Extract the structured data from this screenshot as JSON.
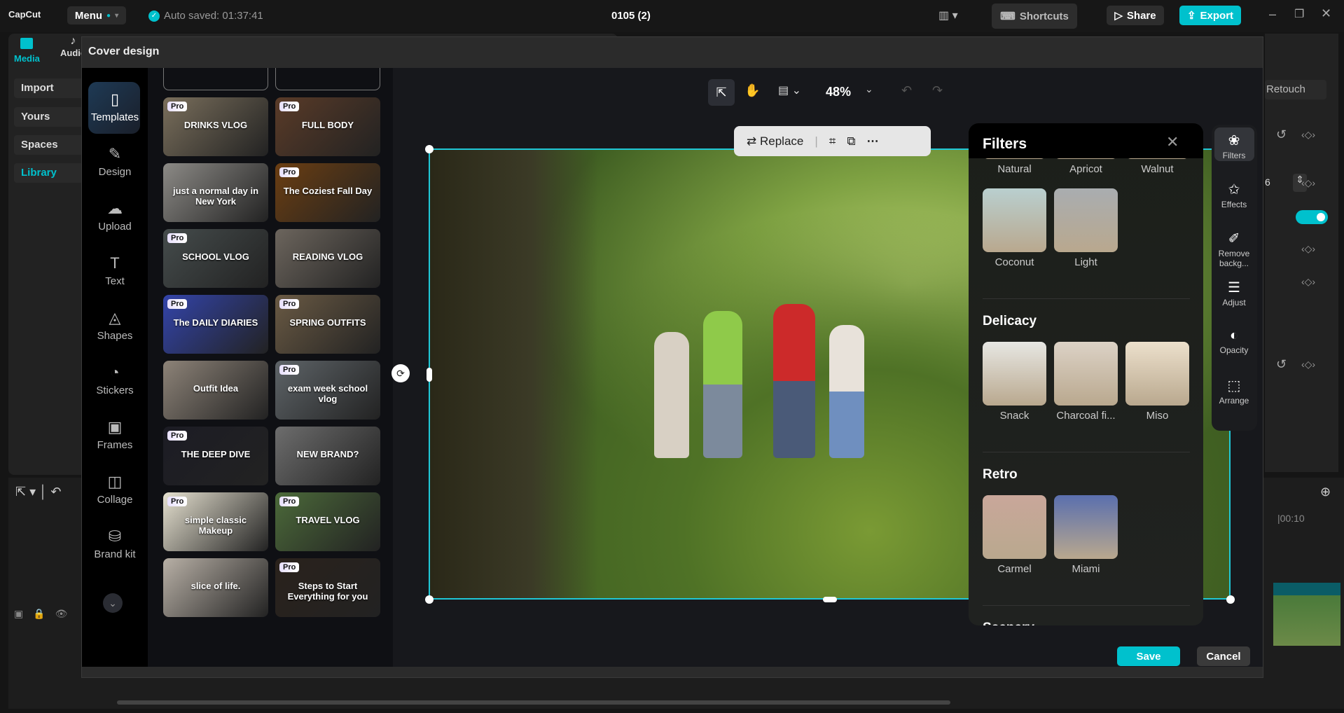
{
  "app": {
    "logo": "CapCut",
    "menu": "Menu",
    "autosave": "Auto saved: 01:37:41",
    "title": "0105 (2)",
    "shortcuts": "Shortcuts",
    "share": "Share",
    "export": "Export"
  },
  "colors": {
    "accent": "#00c1cd",
    "bg": "#151515"
  },
  "media_panel": {
    "tabs": [
      "Media",
      "Audio"
    ],
    "items": [
      "Import",
      "Yours",
      "Spaces",
      "Library"
    ],
    "active": "Library"
  },
  "right_panel": {
    "retouch": "Retouch",
    "value": "6",
    "timecode": "|00:10"
  },
  "modal": {
    "title": "Cover design",
    "save": "Save",
    "cancel": "Cancel",
    "tools": [
      {
        "label": "Templates",
        "icon": "templates-icon"
      },
      {
        "label": "Design",
        "icon": "design-icon"
      },
      {
        "label": "Upload",
        "icon": "upload-icon"
      },
      {
        "label": "Text",
        "icon": "text-icon"
      },
      {
        "label": "Shapes",
        "icon": "shapes-icon"
      },
      {
        "label": "Stickers",
        "icon": "stickers-icon"
      },
      {
        "label": "Frames",
        "icon": "frames-icon"
      },
      {
        "label": "Collage",
        "icon": "collage-icon"
      },
      {
        "label": "Brand kit",
        "icon": "brand-kit-icon"
      }
    ],
    "templates": [
      {
        "text": "DRINKS VLOG",
        "pro": true,
        "bg": "#7a6f5c"
      },
      {
        "text": "FULL BODY",
        "pro": true,
        "bg": "#5a3b28"
      },
      {
        "text": "just a normal day in New York",
        "pro": false,
        "bg": "#8c8a86"
      },
      {
        "text": "The Coziest Fall Day",
        "pro": true,
        "bg": "#6b3e12"
      },
      {
        "text": "SCHOOL VLOG",
        "pro": true,
        "bg": "#454c4c"
      },
      {
        "text": "READING VLOG",
        "pro": false,
        "bg": "#6c655d"
      },
      {
        "text": "The DAILY DIARIES",
        "pro": true,
        "bg": "#3344aa"
      },
      {
        "text": "SPRING OUTFITS",
        "pro": true,
        "bg": "#6a5a44"
      },
      {
        "text": "Outfit Idea",
        "pro": false,
        "bg": "#8d8378"
      },
      {
        "text": "exam week school vlog",
        "pro": true,
        "bg": "#5e6468"
      },
      {
        "text": "THE DEEP DIVE",
        "pro": true,
        "bg": "#1c1c24"
      },
      {
        "text": "NEW BRAND?",
        "pro": false,
        "bg": "#6d6d6d"
      },
      {
        "text": "simple classic Makeup",
        "pro": true,
        "bg": "#e6e1d0"
      },
      {
        "text": "TRAVEL VLOG",
        "pro": true,
        "bg": "#4c6a3a"
      },
      {
        "text": "slice of life.",
        "pro": false,
        "bg": "#b8b0a6"
      },
      {
        "text": "Steps to Start Everything for you",
        "pro": true,
        "bg": "#2a221c"
      }
    ],
    "zoom": "48%",
    "float_toolbar": {
      "replace": "Replace"
    }
  },
  "filters": {
    "title": "Filters",
    "sections": [
      {
        "name": "",
        "items": [
          {
            "label": "Natural",
            "color": "#d8d2c8"
          },
          {
            "label": "Apricot",
            "color": "#efe4d2"
          },
          {
            "label": "Walnut",
            "color": "#eadccb"
          },
          {
            "label": "Coconut",
            "color": "#b9cfcf"
          },
          {
            "label": "Light",
            "color": "#a9adb0"
          }
        ]
      },
      {
        "name": "Delicacy",
        "items": [
          {
            "label": "Snack",
            "color": "#e7e7e3"
          },
          {
            "label": "Charcoal fi...",
            "color": "#dcd2c6"
          },
          {
            "label": "Miso",
            "color": "#ece0cc"
          }
        ]
      },
      {
        "name": "Retro",
        "items": [
          {
            "label": "Carmel",
            "color": "#c9a79a"
          },
          {
            "label": "Miami",
            "color": "#5a6fae"
          }
        ]
      },
      {
        "name": "Scenery",
        "items": []
      }
    ]
  },
  "right_tools": [
    {
      "label": "Filters",
      "icon": "filters-icon"
    },
    {
      "label": "Effects",
      "icon": "effects-icon"
    },
    {
      "label": "Remove backg...",
      "icon": "remove-background-icon"
    },
    {
      "label": "Adjust",
      "icon": "adjust-icon"
    },
    {
      "label": "Opacity",
      "icon": "opacity-icon"
    },
    {
      "label": "Arrange",
      "icon": "arrange-icon"
    }
  ]
}
